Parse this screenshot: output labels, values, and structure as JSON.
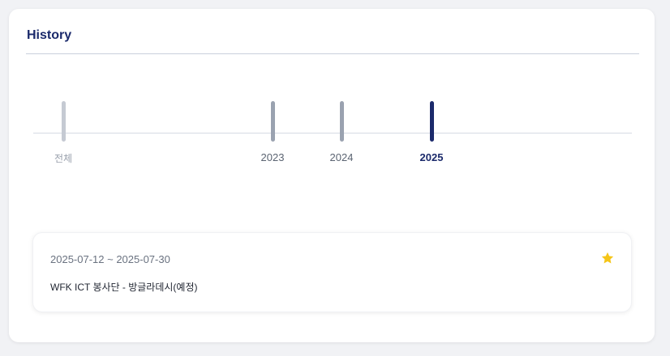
{
  "section": {
    "title": "History"
  },
  "timeline": {
    "items": [
      {
        "label": "전체",
        "state": "all"
      },
      {
        "label": "2023",
        "state": "inactive"
      },
      {
        "label": "2024",
        "state": "inactive"
      },
      {
        "label": "2025",
        "state": "active"
      }
    ]
  },
  "events": [
    {
      "date_range": "2025-07-12 ~ 2025-07-30",
      "title": "WFK ICT 봉사단 - 방글라데시(예정)",
      "starred": true
    }
  ],
  "colors": {
    "accent": "#1b2a6b",
    "star": "#f5c518",
    "tick_inactive": "#9aa2b0",
    "tick_all": "#c5cad3"
  },
  "icons": {
    "favorite": "star-icon"
  }
}
